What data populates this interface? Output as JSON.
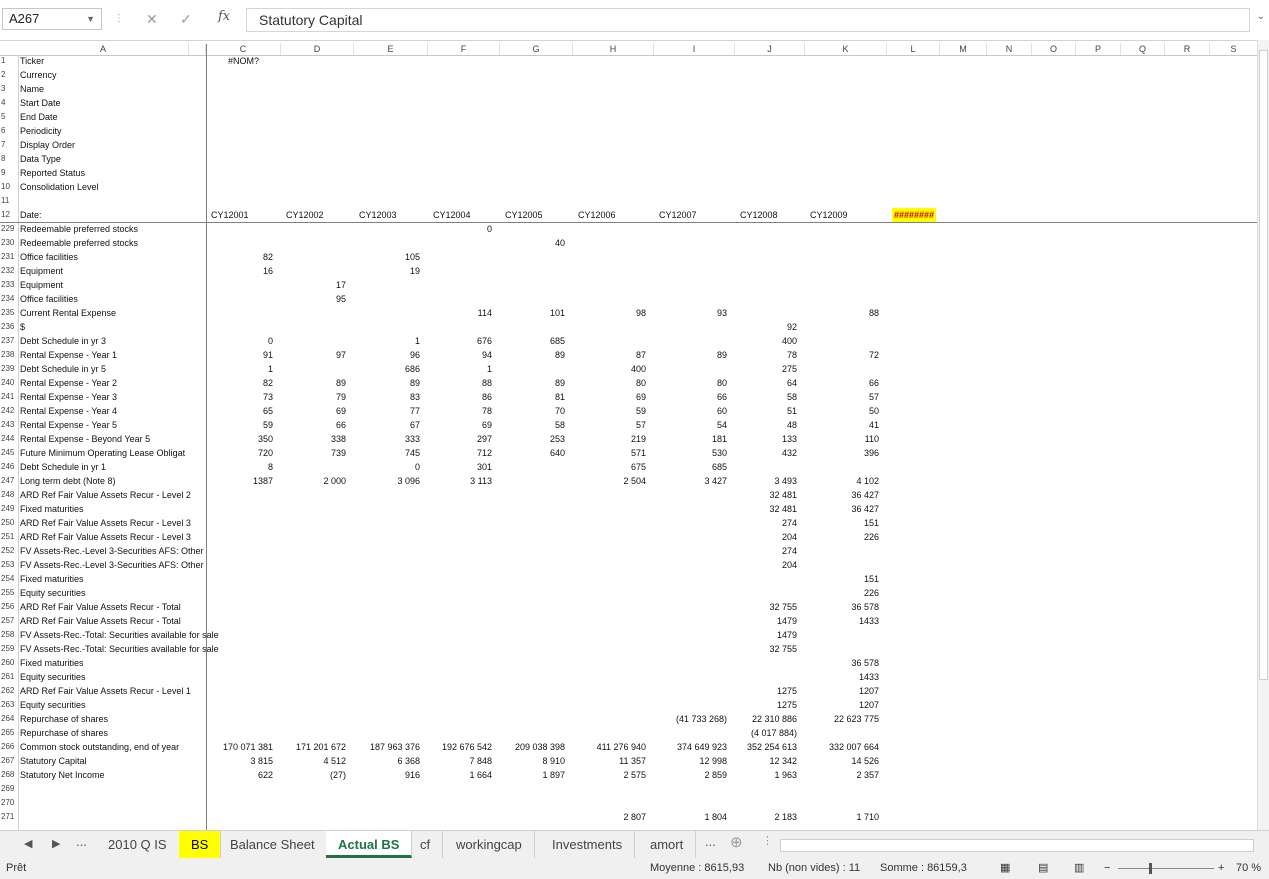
{
  "formula_bar": {
    "name_box": "A267",
    "fx": "fx",
    "content": "Statutory Capital"
  },
  "columns": [
    "A",
    "",
    "C",
    "D",
    "E",
    "F",
    "G",
    "H",
    "I",
    "J",
    "K",
    "L",
    "M",
    "N",
    "O",
    "P",
    "Q",
    "R",
    "S"
  ],
  "rows": [
    {
      "n": "1",
      "label": "Ticker",
      "v": {
        "C": "#NOM?"
      }
    },
    {
      "n": "2",
      "label": "Currency",
      "v": {}
    },
    {
      "n": "3",
      "label": "Name",
      "v": {}
    },
    {
      "n": "4",
      "label": "Start Date",
      "v": {}
    },
    {
      "n": "5",
      "label": "End Date",
      "v": {}
    },
    {
      "n": "6",
      "label": "Periodicity",
      "v": {}
    },
    {
      "n": "7",
      "label": "Display Order",
      "v": {}
    },
    {
      "n": "8",
      "label": "Data Type",
      "v": {}
    },
    {
      "n": "9",
      "label": "Reported Status",
      "v": {}
    },
    {
      "n": "10",
      "label": "Consolidation Level",
      "v": {}
    },
    {
      "n": "11",
      "label": "",
      "v": {}
    },
    {
      "n": "12",
      "label": "Date:",
      "v": {
        "C": "CY12001",
        "D": "CY12002",
        "E": "CY12003",
        "F": "CY12004",
        "G": "CY12005",
        "H": "CY12006",
        "I": "CY12007",
        "J": "CY12008",
        "K": "CY12009",
        "L": "########"
      }
    },
    {
      "n": "229",
      "label": "Redeemable preferred stocks",
      "v": {
        "F": "0"
      }
    },
    {
      "n": "230",
      "label": "Redeemable preferred stocks",
      "v": {
        "G": "40"
      }
    },
    {
      "n": "231",
      "label": "Office facilities",
      "v": {
        "C": "82",
        "E": "105"
      }
    },
    {
      "n": "232",
      "label": "Equipment",
      "v": {
        "C": "16",
        "E": "19"
      }
    },
    {
      "n": "233",
      "label": "Equipment",
      "v": {
        "D": "17"
      }
    },
    {
      "n": "234",
      "label": "Office facilities",
      "v": {
        "D": "95"
      }
    },
    {
      "n": "235",
      "label": "Current Rental Expense",
      "v": {
        "F": "114",
        "G": "101",
        "H": "98",
        "I": "93",
        "K": "88"
      }
    },
    {
      "n": "236",
      "label": "$",
      "v": {
        "J": "92"
      }
    },
    {
      "n": "237",
      "label": "Debt Schedule in yr 3",
      "v": {
        "C": "0",
        "E": "1",
        "F": "676",
        "G": "685",
        "J": "400"
      }
    },
    {
      "n": "238",
      "label": "Rental Expense - Year 1",
      "v": {
        "C": "91",
        "D": "97",
        "E": "96",
        "F": "94",
        "G": "89",
        "H": "87",
        "I": "89",
        "J": "78",
        "K": "72"
      }
    },
    {
      "n": "239",
      "label": "Debt Schedule in yr 5",
      "v": {
        "C": "1",
        "E": "686",
        "F": "1",
        "H": "400",
        "J": "275"
      }
    },
    {
      "n": "240",
      "label": "Rental Expense - Year 2",
      "v": {
        "C": "82",
        "D": "89",
        "E": "89",
        "F": "88",
        "G": "89",
        "H": "80",
        "I": "80",
        "J": "64",
        "K": "66"
      }
    },
    {
      "n": "241",
      "label": "Rental Expense - Year 3",
      "v": {
        "C": "73",
        "D": "79",
        "E": "83",
        "F": "86",
        "G": "81",
        "H": "69",
        "I": "66",
        "J": "58",
        "K": "57"
      }
    },
    {
      "n": "242",
      "label": "Rental Expense - Year 4",
      "v": {
        "C": "65",
        "D": "69",
        "E": "77",
        "F": "78",
        "G": "70",
        "H": "59",
        "I": "60",
        "J": "51",
        "K": "50"
      }
    },
    {
      "n": "243",
      "label": "Rental Expense - Year 5",
      "v": {
        "C": "59",
        "D": "66",
        "E": "67",
        "F": "69",
        "G": "58",
        "H": "57",
        "I": "54",
        "J": "48",
        "K": "41"
      }
    },
    {
      "n": "244",
      "label": "Rental Expense - Beyond Year 5",
      "v": {
        "C": "350",
        "D": "338",
        "E": "333",
        "F": "297",
        "G": "253",
        "H": "219",
        "I": "181",
        "J": "133",
        "K": "110"
      }
    },
    {
      "n": "245",
      "label": "Future Minimum Operating Lease Obligat",
      "v": {
        "C": "720",
        "D": "739",
        "E": "745",
        "F": "712",
        "G": "640",
        "H": "571",
        "I": "530",
        "J": "432",
        "K": "396"
      }
    },
    {
      "n": "246",
      "label": "Debt Schedule in yr 1",
      "v": {
        "C": "8",
        "E": "0",
        "F": "301",
        "H": "675",
        "I": "685"
      }
    },
    {
      "n": "247",
      "label": "Long term debt (Note 8)",
      "v": {
        "C": "1387",
        "D": "2 000",
        "E": "3 096",
        "F": "3 113",
        "H": "2 504",
        "I": "3 427",
        "J": "3 493",
        "K": "4 102"
      }
    },
    {
      "n": "248",
      "label": "ARD Ref Fair Value Assets Recur - Level 2",
      "v": {
        "J": "32 481",
        "K": "36 427"
      }
    },
    {
      "n": "249",
      "label": "Fixed maturities",
      "v": {
        "J": "32 481",
        "K": "36 427"
      }
    },
    {
      "n": "250",
      "label": "ARD Ref Fair Value Assets Recur - Level 3",
      "v": {
        "J": "274",
        "K": "151"
      }
    },
    {
      "n": "251",
      "label": "ARD Ref Fair Value Assets Recur - Level 3",
      "v": {
        "J": "204",
        "K": "226"
      }
    },
    {
      "n": "252",
      "label": "FV Assets-Rec.-Level 3-Securities AFS: Other",
      "v": {
        "J": "274"
      }
    },
    {
      "n": "253",
      "label": "FV Assets-Rec.-Level 3-Securities AFS: Other",
      "v": {
        "J": "204"
      }
    },
    {
      "n": "254",
      "label": "Fixed maturities",
      "v": {
        "K": "151"
      }
    },
    {
      "n": "255",
      "label": "Equity securities",
      "v": {
        "K": "226"
      }
    },
    {
      "n": "256",
      "label": "ARD Ref Fair Value Assets Recur - Total",
      "v": {
        "J": "32 755",
        "K": "36 578"
      }
    },
    {
      "n": "257",
      "label": "ARD Ref Fair Value Assets Recur - Total",
      "v": {
        "J": "1479",
        "K": "1433"
      }
    },
    {
      "n": "258",
      "label": "FV Assets-Rec.-Total: Securities available for sale",
      "v": {
        "J": "1479"
      }
    },
    {
      "n": "259",
      "label": "FV Assets-Rec.-Total: Securities available for sale",
      "v": {
        "J": "32 755"
      }
    },
    {
      "n": "260",
      "label": "Fixed maturities",
      "v": {
        "K": "36 578"
      }
    },
    {
      "n": "261",
      "label": "Equity securities",
      "v": {
        "K": "1433"
      }
    },
    {
      "n": "262",
      "label": "ARD Ref Fair Value Assets Recur - Level 1",
      "v": {
        "J": "1275",
        "K": "1207"
      }
    },
    {
      "n": "263",
      "label": "Equity securities",
      "v": {
        "J": "1275",
        "K": "1207"
      }
    },
    {
      "n": "264",
      "label": "Repurchase of shares",
      "v": {
        "I": "(41 733 268)",
        "J": "22 310 886",
        "K": "22 623 775"
      }
    },
    {
      "n": "265",
      "label": "Repurchase of shares",
      "v": {
        "J": "(4 017 884)"
      }
    },
    {
      "n": "266",
      "label": "Common stock outstanding, end of year",
      "v": {
        "C": "170 071 381",
        "D": "171 201 672",
        "E": "187 963 376",
        "F": "192 676 542",
        "G": "209 038 398",
        "H": "411 276 940",
        "I": "374 649 923",
        "J": "352 254 613",
        "K": "332 007 664"
      }
    },
    {
      "n": "267",
      "label": "Statutory Capital",
      "v": {
        "C": "3 815",
        "D": "4 512",
        "E": "6 368",
        "F": "7 848",
        "G": "8 910",
        "H": "11 357",
        "I": "12 998",
        "J": "12 342",
        "K": "14 526"
      }
    },
    {
      "n": "268",
      "label": "Statutory Net Income",
      "v": {
        "C": "622",
        "D": "(27)",
        "E": "916",
        "F": "1 664",
        "G": "1 897",
        "H": "2 575",
        "I": "2 859",
        "J": "1 963",
        "K": "2 357"
      }
    },
    {
      "n": "269",
      "label": "",
      "v": {}
    },
    {
      "n": "270",
      "label": "",
      "v": {}
    },
    {
      "n": "271",
      "label": "",
      "v": {
        "H": "2 807",
        "I": "1 804",
        "J": "2 183",
        "K": "1 710"
      }
    }
  ],
  "tabs": {
    "prev_ellipsis": "...",
    "items": [
      "2010 Q IS",
      "BS",
      "Balance Sheet",
      "Actual BS",
      "cf",
      "workingcap",
      "Investments",
      "amort"
    ],
    "active": "Actual BS",
    "highlighted": "BS",
    "more": "..."
  },
  "status": {
    "ready": "Prêt",
    "average": "Moyenne : 8615,93",
    "count": "Nb (non vides) : 11",
    "sum": "Somme : 86159,3",
    "zoom": "70 %"
  }
}
